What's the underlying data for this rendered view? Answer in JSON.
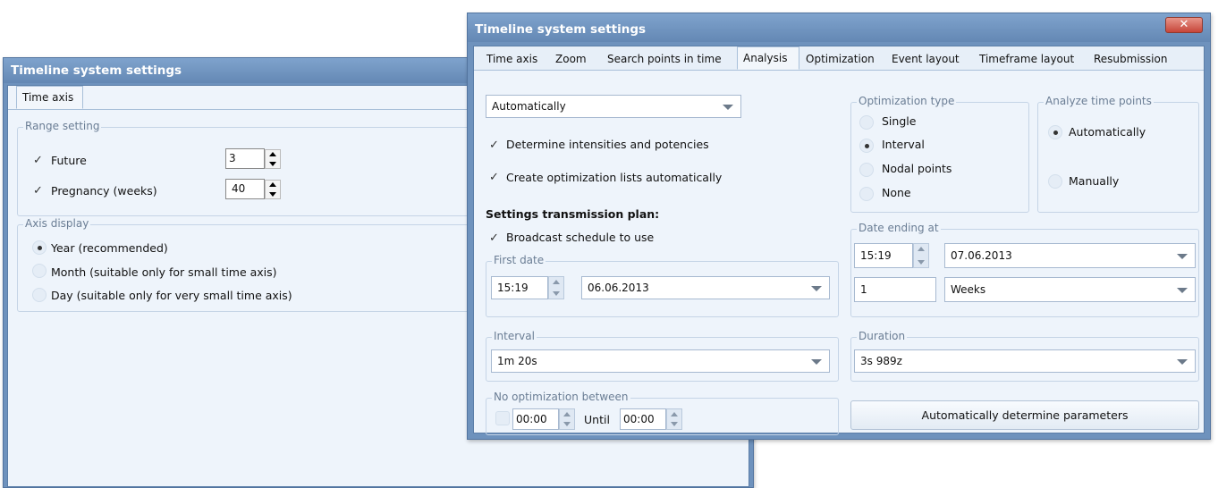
{
  "back_window": {
    "title": "Timeline system settings",
    "tab": "Time axis",
    "range_setting": {
      "legend": "Range setting",
      "future_label": "Future",
      "future_value": "3",
      "pregnancy_label": "Pregnancy (weeks)",
      "pregnancy_value": "40"
    },
    "axis_display": {
      "legend": "Axis display",
      "options": [
        "Year (recommended)",
        "Month (suitable only for small time axis)",
        "Day (suitable only for very small time axis)"
      ],
      "selected": "Year (recommended)"
    }
  },
  "front_window": {
    "title": "Timeline system settings",
    "close_glyph": "✕",
    "tabs": [
      "Time axis",
      "Zoom",
      "Search points in time",
      "Analysis",
      "Optimization",
      "Event layout",
      "Timeframe layout",
      "Resubmission"
    ],
    "active_tab": "Analysis",
    "mode_select": "Automatically",
    "determine_intensities_label": "Determine intensities and potencies",
    "create_lists_label": "Create optimization lists automatically",
    "optimization_type": {
      "legend": "Optimization type",
      "options": [
        "Single",
        "Interval",
        "Nodal points",
        "None"
      ],
      "selected": "Interval"
    },
    "analyze_time_points": {
      "legend": "Analyze time points",
      "options": [
        "Automatically",
        "Manually"
      ],
      "selected": "Automatically"
    },
    "transmission_heading": "Settings transmission plan:",
    "broadcast_label": "Broadcast schedule to use",
    "first_date": {
      "legend": "First date",
      "time": "15:19",
      "date": "06.06.2013"
    },
    "date_ending": {
      "legend": "Date ending at",
      "time": "15:19",
      "date": "07.06.2013",
      "count": "1",
      "unit": "Weeks"
    },
    "interval": {
      "legend": "Interval",
      "value": "1m 20s"
    },
    "duration": {
      "legend": "Duration",
      "value": "3s 989z"
    },
    "no_optimization": {
      "legend": "No optimization between",
      "from": "00:00",
      "until_label": "Until",
      "to": "00:00"
    },
    "auto_button": "Automatically determine parameters"
  }
}
